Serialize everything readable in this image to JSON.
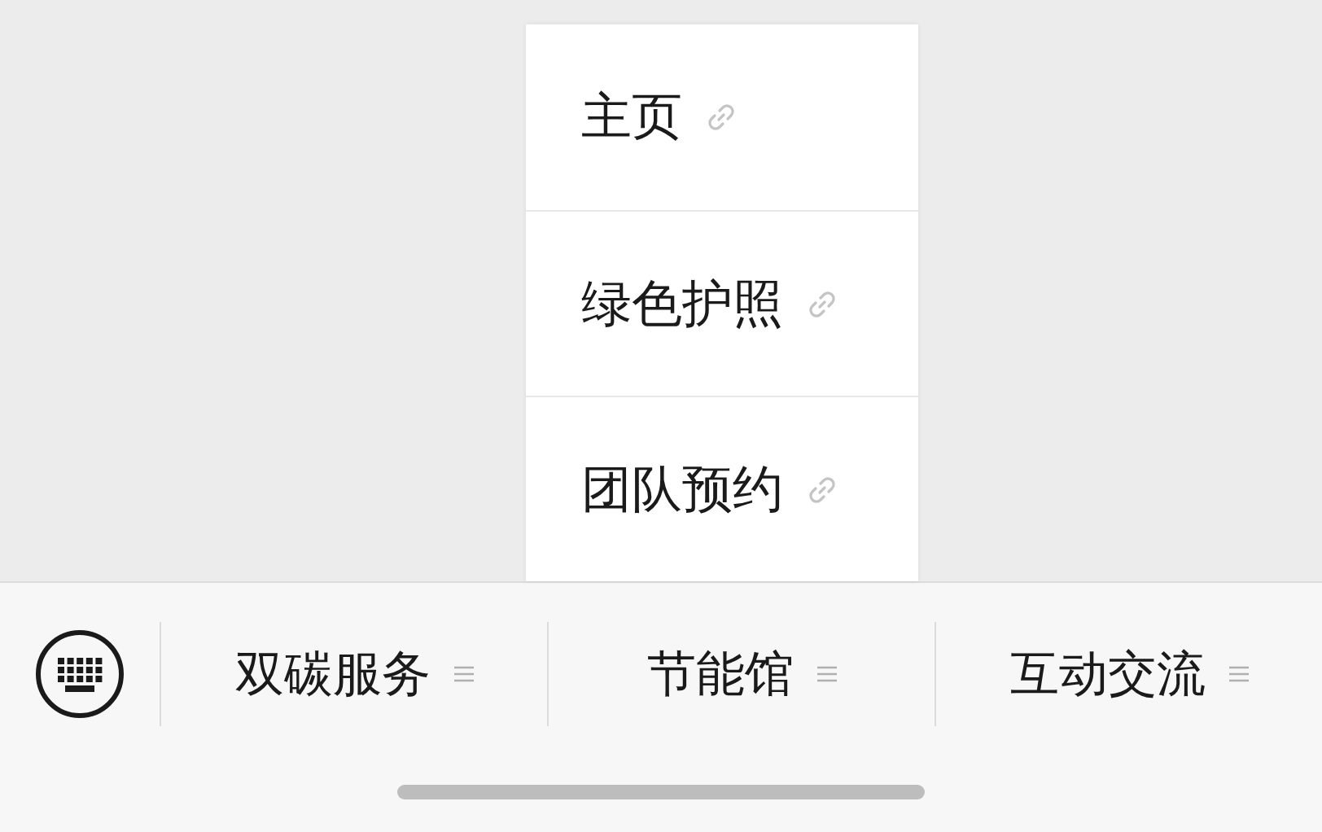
{
  "menu_bar": {
    "items": [
      {
        "label": "双碳服务"
      },
      {
        "label": "节能馆",
        "submenu": [
          {
            "label": "主页"
          },
          {
            "label": "绿色护照"
          },
          {
            "label": "团队预约"
          }
        ]
      },
      {
        "label": "互动交流"
      }
    ]
  }
}
